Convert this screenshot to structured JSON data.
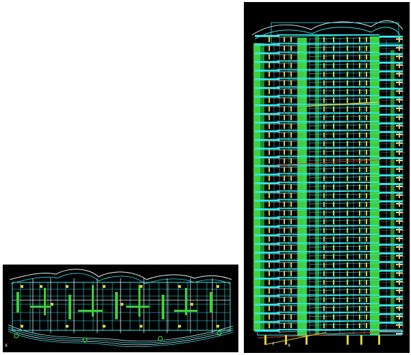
{
  "colors": {
    "background": "#000000",
    "page": "#ffffff",
    "slab_cyan": "#33e6ec",
    "wall_green": "#3fcf3a",
    "wall_green_dark": "#1f8f2a",
    "column_yellow": "#e0cf3a",
    "beam_red": "#d03a2a",
    "outline_white": "#e6f2f2"
  },
  "plan_view": {
    "axis_mark": "X"
  },
  "tower_view": {
    "floors": 34,
    "axis_labels": {
      "y": "Y",
      "x": "X"
    }
  }
}
